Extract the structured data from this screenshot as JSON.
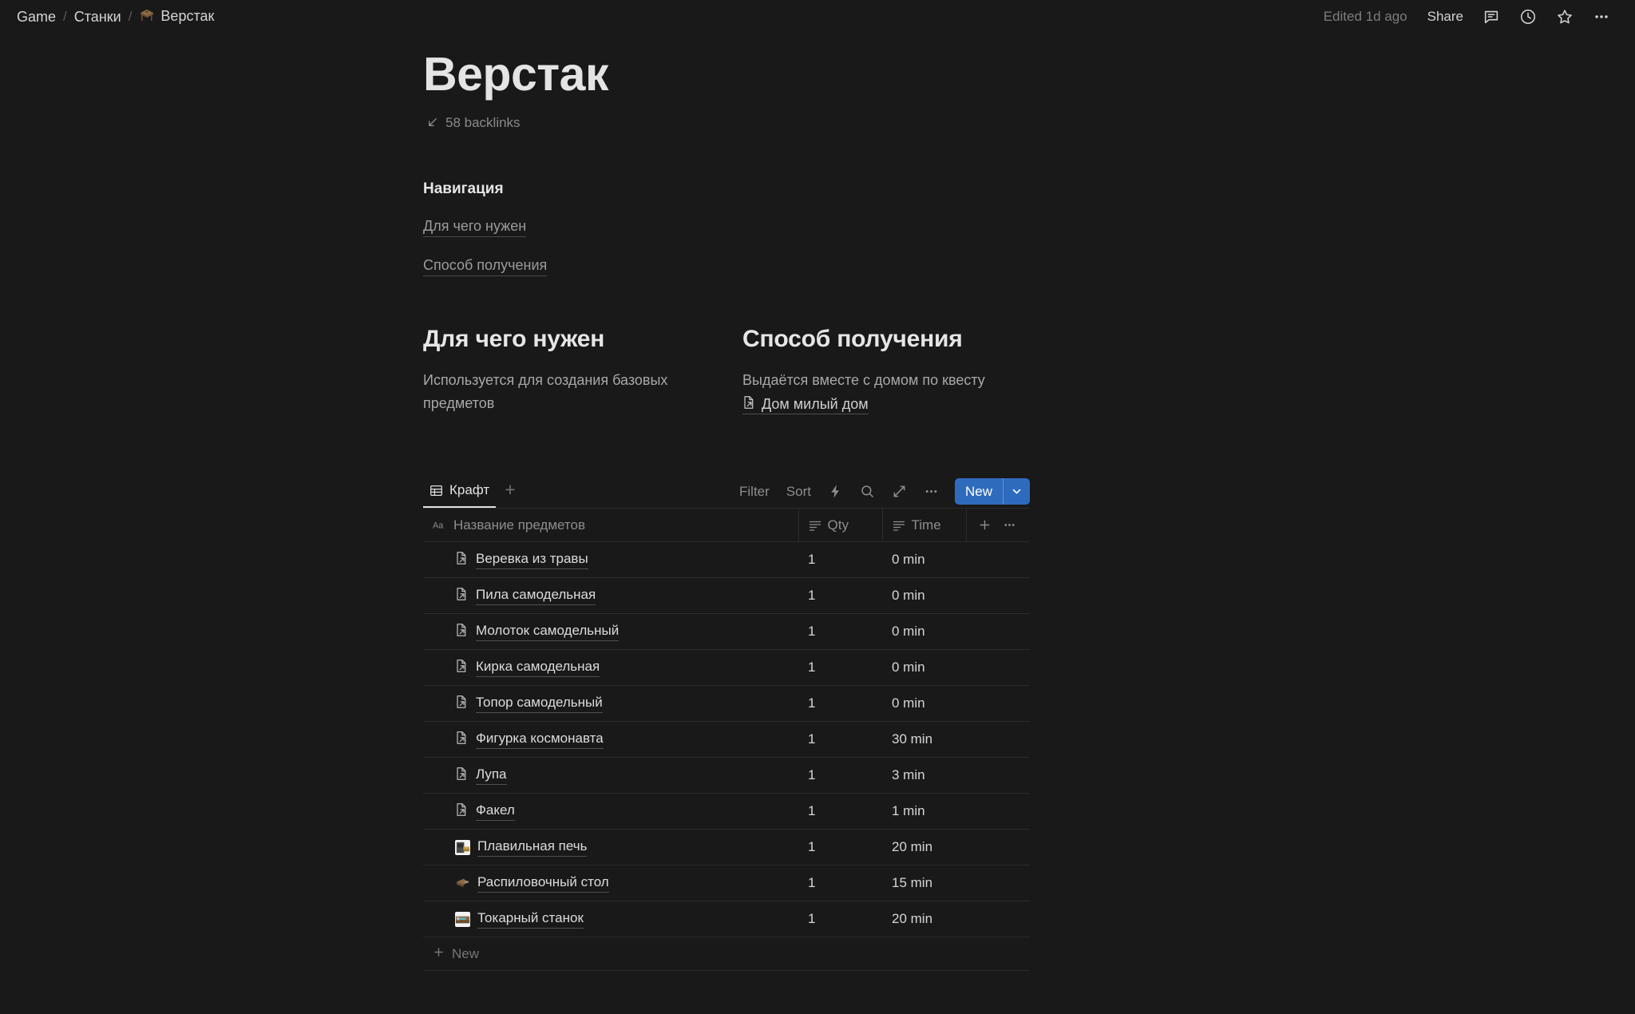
{
  "topbar": {
    "breadcrumbs": [
      {
        "label": "Game",
        "icon": ""
      },
      {
        "label": "Станки",
        "icon": ""
      },
      {
        "label": "Верстак",
        "icon": "workbench-emoji"
      }
    ],
    "separator": "/",
    "edited": "Edited 1d ago",
    "share": "Share",
    "icons": [
      "comment-icon",
      "history-clock-icon",
      "star-icon",
      "more-options-icon"
    ]
  },
  "page": {
    "title": "Верстак",
    "backlinks": "58 backlinks",
    "backlinks_icon": "arrow-down-left-icon"
  },
  "navigation": {
    "heading": "Навигация",
    "links": [
      "Для чего нужен",
      "Способ получения"
    ]
  },
  "columns": [
    {
      "heading": "Для чего нужен",
      "paragraph": "Используется для создания базовых предметов",
      "link": null
    },
    {
      "heading": "Способ получения",
      "paragraph": "Выдаётся вместе с домом по квесту",
      "link": "Дом милый дом"
    }
  ],
  "database": {
    "tab": {
      "label": "Крафт",
      "icon": "table-icon"
    },
    "add_view": "+",
    "tools": {
      "filter": "Filter",
      "sort": "Sort",
      "automation_icon": "lightning-icon",
      "search_icon": "search-icon",
      "expand_icon": "expand-icon",
      "more_icon": "more-options-icon"
    },
    "new_button": {
      "label": "New",
      "chevron": "chevron-down-icon",
      "color": "#2f6bbd"
    },
    "headers": [
      {
        "label": "Название предметов",
        "icon": "title-aa-icon"
      },
      {
        "label": "Qty",
        "icon": "text-property-icon"
      },
      {
        "label": "Time",
        "icon": "text-property-icon"
      }
    ],
    "header_actions": [
      "add-property-icon",
      "more-options-icon"
    ],
    "rows": [
      {
        "name": "Веревка из травы",
        "icon": "page-link-icon",
        "qty": "1",
        "time": "0 min"
      },
      {
        "name": "Пила самодельная",
        "icon": "page-link-icon",
        "qty": "1",
        "time": "0 min"
      },
      {
        "name": "Молоток самодельный",
        "icon": "page-link-icon",
        "qty": "1",
        "time": "0 min"
      },
      {
        "name": "Кирка самодельная",
        "icon": "page-link-icon",
        "qty": "1",
        "time": "0 min"
      },
      {
        "name": "Топор самодельный",
        "icon": "page-link-icon",
        "qty": "1",
        "time": "0 min"
      },
      {
        "name": "Фигурка космонавта",
        "icon": "page-link-icon",
        "qty": "1",
        "time": "30 min"
      },
      {
        "name": "Лупа",
        "icon": "page-link-icon",
        "qty": "1",
        "time": "3 min"
      },
      {
        "name": "Факел",
        "icon": "page-link-icon",
        "qty": "1",
        "time": "1 min"
      },
      {
        "name": "Плавильная печь",
        "icon": "thumbnail-furnace",
        "qty": "1",
        "time": "20 min"
      },
      {
        "name": "Распиловочный стол",
        "icon": "thumbnail-sawtable",
        "qty": "1",
        "time": "15 min"
      },
      {
        "name": "Токарный станок",
        "icon": "thumbnail-lathe",
        "qty": "1",
        "time": "20 min"
      }
    ],
    "new_row": {
      "label": "New",
      "icon": "plus-icon"
    }
  }
}
